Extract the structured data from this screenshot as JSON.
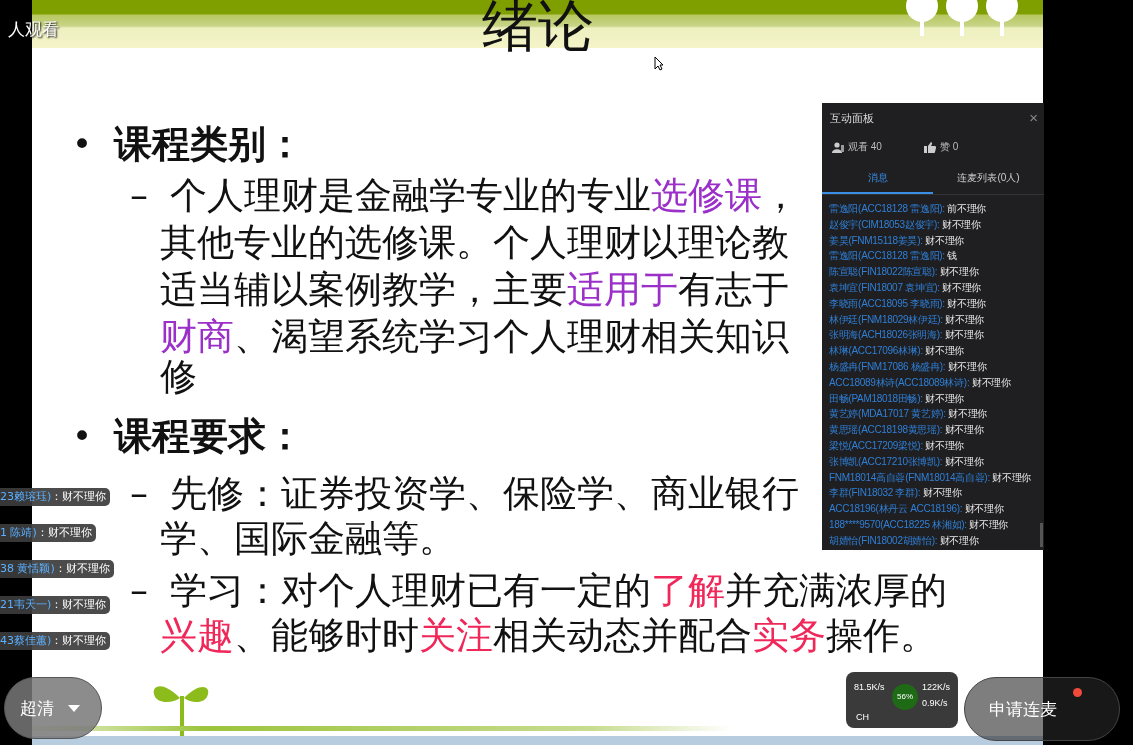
{
  "viewers_label": "人观看",
  "slide": {
    "title": "绪论",
    "sections": [
      {
        "marker": "•",
        "heading": "课程类别：",
        "items": [
          {
            "marker": "–",
            "lines": [
              [
                {
                  "text": "个人理财是金融学专业的专业"
                },
                {
                  "text": "选修课",
                  "color": "#9b30c8"
                },
                {
                  "text": "，"
                }
              ],
              [
                {
                  "text": "其他专业的选修课。个人理财以理论教"
                }
              ],
              [
                {
                  "text": "适当辅以案例教学，主要"
                },
                {
                  "text": "适用于",
                  "color": "#9b30c8"
                },
                {
                  "text": "有志于"
                }
              ],
              [
                {
                  "text": "财商",
                  "color": "#9b30c8"
                },
                {
                  "text": "、渴望系统学习个人理财相关知识"
                }
              ],
              [
                {
                  "text": "修"
                }
              ]
            ]
          }
        ]
      },
      {
        "marker": "•",
        "heading": "课程要求：",
        "items": [
          {
            "marker": "–",
            "lines": [
              [
                {
                  "text": "先修：证券投资学、保险学、商业银行"
                }
              ],
              [
                {
                  "text": "学、国际金融等。"
                }
              ]
            ]
          },
          {
            "marker": "–",
            "lines": [
              [
                {
                  "text": "学习：对个人理财已有一定的"
                },
                {
                  "text": "了解",
                  "color": "#f0285a"
                },
                {
                  "text": "并充满浓厚的"
                }
              ],
              [
                {
                  "text": "兴趣",
                  "color": "#f0285a"
                },
                {
                  "text": "、能够时时"
                },
                {
                  "text": "关注",
                  "color": "#f0285a"
                },
                {
                  "text": "相关动态并配合"
                },
                {
                  "text": "实务",
                  "color": "#f0285a"
                },
                {
                  "text": "操作。"
                }
              ]
            ]
          }
        ]
      }
    ]
  },
  "danmaku": [
    {
      "name": "23赖瑢珏)",
      "message": "：财不理你"
    },
    {
      "name": "1 陈靖)",
      "message": "：财不理你"
    },
    {
      "name": "38 黄恬颖)",
      "message": "：财不理你"
    },
    {
      "name": "21韦天一)",
      "message": "：财不理你"
    },
    {
      "name": "43蔡佳蕙)",
      "message": "：财不理你"
    }
  ],
  "panel": {
    "title": "互动面板",
    "close": "×",
    "viewers": "观看 40",
    "likes": "赞 0",
    "tabs": [
      {
        "label": "消息",
        "selected": true
      },
      {
        "label": "连麦列表(0人)",
        "selected": false
      }
    ],
    "messages": [
      {
        "name": "雷逸阳(ACC18128 雷逸阳):",
        "text": "前不理你"
      },
      {
        "name": "赵俊宇(CIM18053赵俊宇):",
        "text": "财不理你"
      },
      {
        "name": "姜昊(FNM15118姜昊):",
        "text": "财不理你"
      },
      {
        "name": "雷逸阳(ACC18128 雷逸阳):",
        "text": "钱"
      },
      {
        "name": "陈宣聪(FIN18022陈宣聪):",
        "text": "财不理你"
      },
      {
        "name": "袁坤宜(FIN18007 袁坤宜):",
        "text": "财不理你"
      },
      {
        "name": "李晓雨(ACC18095 李晓雨):",
        "text": "财不理你"
      },
      {
        "name": "林伊廷(FNM18029林伊廷):",
        "text": "财不理你"
      },
      {
        "name": "张明海(ACH18026张明海):",
        "text": "财不理你"
      },
      {
        "name": "林琳(ACC17096林琳):",
        "text": "财不理你"
      },
      {
        "name": "杨盛冉(FNM17086 杨盛冉):",
        "text": "财不理你"
      },
      {
        "name": "ACC18089林诗(ACC18089林诗):",
        "text": "财不理你"
      },
      {
        "name": "田畅(PAM18018田畅):",
        "text": "财不理你"
      },
      {
        "name": "黄艺婷(MDA17017 黄艺婷):",
        "text": "财不理你"
      },
      {
        "name": "黄思瑶(ACC18198黄思瑶):",
        "text": "财不理你"
      },
      {
        "name": "梁悦(ACC17209梁悦):",
        "text": "财不理你"
      },
      {
        "name": "张博凯(ACC17210张博凯):",
        "text": "财不理你"
      },
      {
        "name": "FNM18014高自蓉(FNM18014高自蓉):",
        "text": "财不理你"
      },
      {
        "name": "李群(FIN18032 李群):",
        "text": "财不理你"
      },
      {
        "name": "ACC18196(林丹云 ACC18196):",
        "text": "财不理你"
      },
      {
        "name": "188****9570(ACC18225 林湘如):",
        "text": "财不理你"
      },
      {
        "name": "胡婧怡(FIN18002胡婧怡):",
        "text": "财不理你"
      }
    ]
  },
  "quality": "超清",
  "tray": {
    "down": "81.5K/s",
    "percent": "56%",
    "up_speed": "122K/s",
    "down_speed": "0.9K/s",
    "ime": "CH"
  },
  "mic_button": "申请连麦"
}
